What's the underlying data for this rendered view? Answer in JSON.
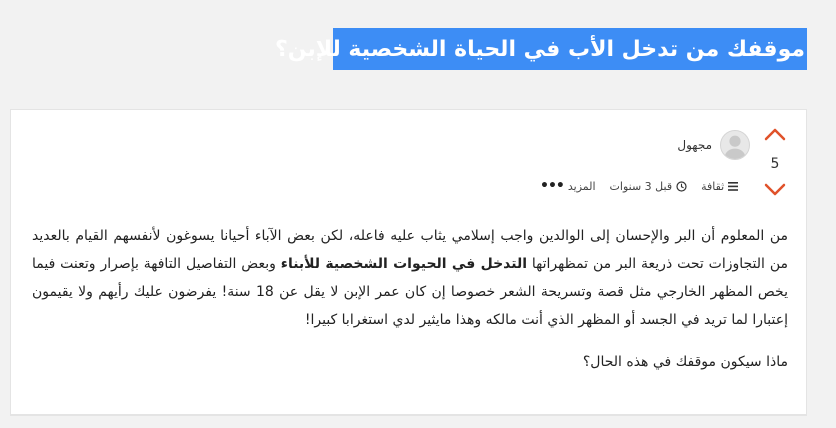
{
  "question": {
    "title": "موقفك من تدخل الأب في الحياة الشخصية للإبن؟"
  },
  "post": {
    "votes": "5",
    "author": "مجهول",
    "meta": {
      "category": "ثقافة",
      "time": "قبل 3 سنوات",
      "more": "المزيد"
    },
    "body": {
      "p1_part1": "من المعلوم أن البر والإحسان إلى الوالدين واجب إسلامي يثاب عليه فاعله، لكن بعض الآباء أحيانا يسوغون لأنفسهم القيام بالعديد من التجاوزات تحت ذريعة البر من تمظهراتها ",
      "p1_bold": "التدخل في الحيوات الشخصية للأبناء",
      "p1_part2": " وبعض التفاصيل التافهة بإصرار وتعنت فيما يخص المظهر الخارجي مثل قصة وتسريحة الشعر خصوصا إن كان عمر الإبن لا يقل عن 18 سنة! يفرضون عليك رأيهم ولا يقيمون إعتبارا لما تريد في الجسد أو المظهر الذي أنت مالكه وهذا مايثير لدي استغرابا كبيرا!",
      "p2": "ماذا سيكون موقفك في هذه الحال؟"
    }
  },
  "colors": {
    "title_bg": "#3d8df5",
    "vote_arrow": "#e0522a"
  },
  "icons": {
    "vote_up": "chevron-up-icon",
    "vote_down": "chevron-down-icon",
    "avatar": "user-avatar-icon",
    "category": "list-icon",
    "time": "clock-icon",
    "more": "ellipsis-icon"
  }
}
